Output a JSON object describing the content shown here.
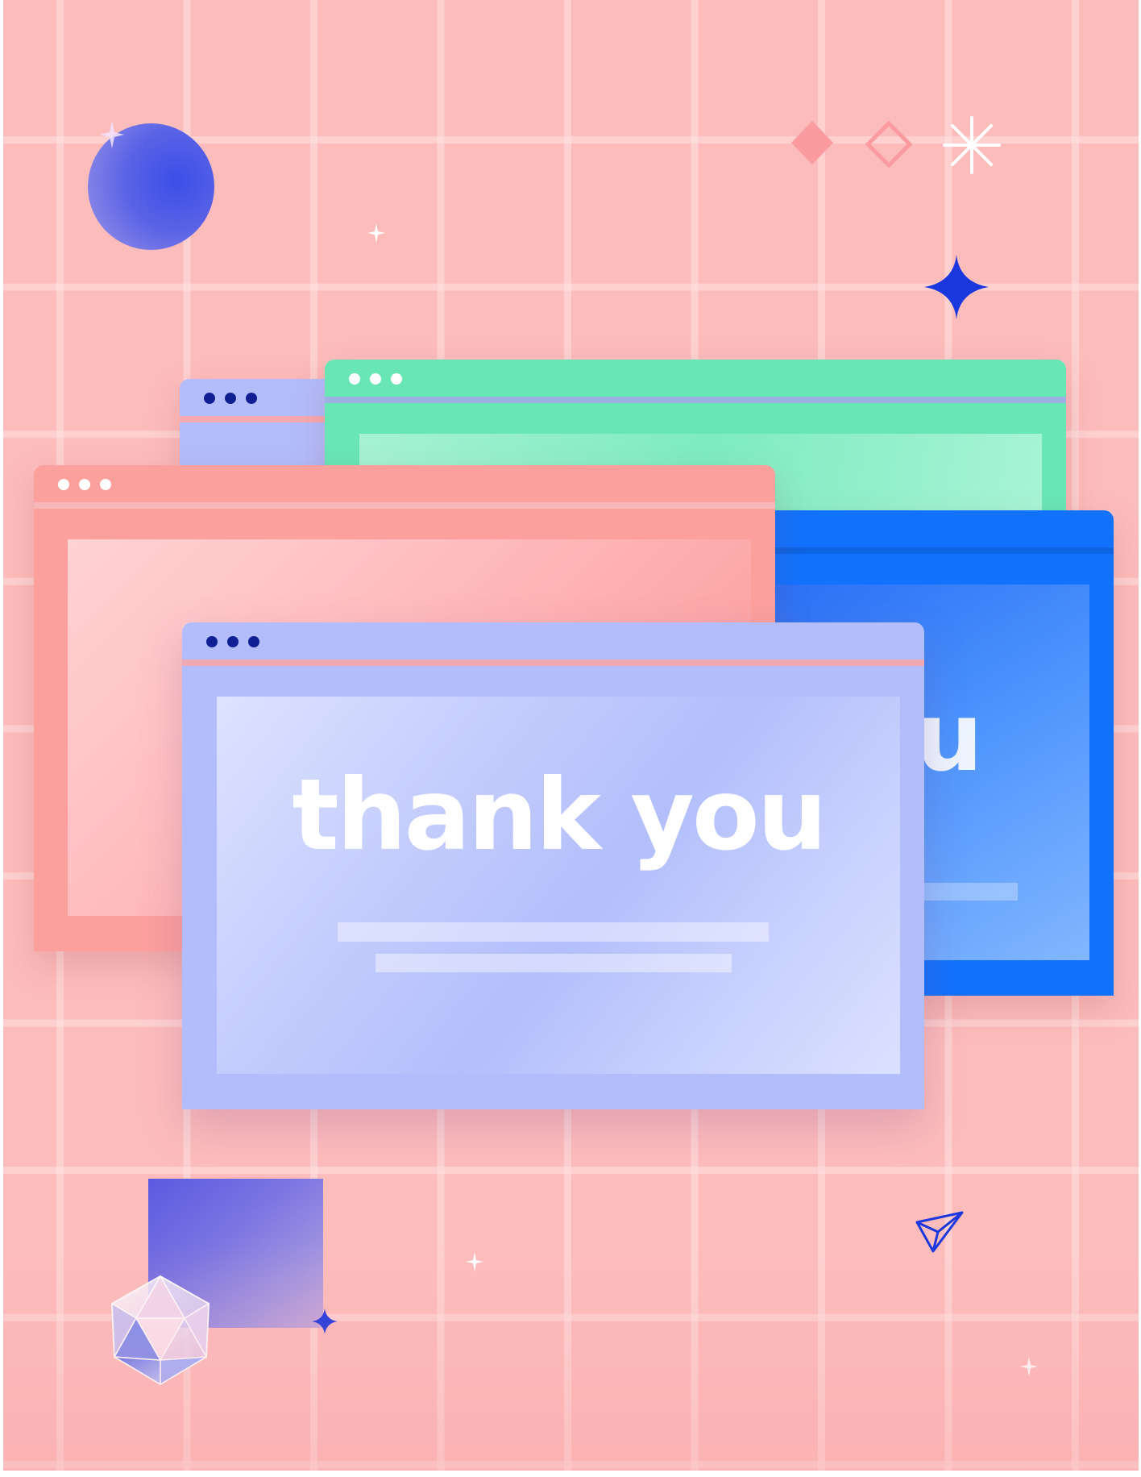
{
  "headline": "thank you",
  "ghost_text": "u",
  "colors": {
    "background": "#fdbcbc",
    "lavender": "#b3bdfb",
    "green": "#68e6b4",
    "blue": "#1272fd",
    "salmon": "#fca09e",
    "navy_accent": "#1b37de"
  },
  "icons": [
    "planet-circle-icon",
    "filled-diamond-icon",
    "outline-diamond-icon",
    "starburst-icon",
    "blue-four-point-star-icon",
    "paper-plane-icon",
    "crystal-gem-icon",
    "gradient-square-icon",
    "sparkle-icon"
  ]
}
